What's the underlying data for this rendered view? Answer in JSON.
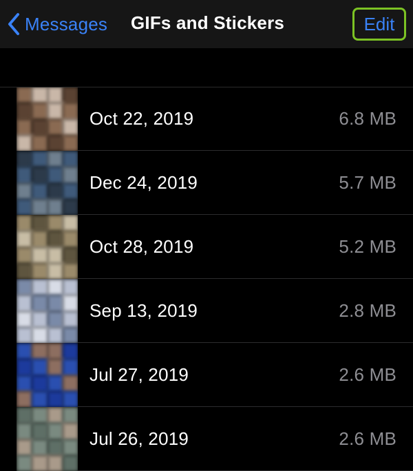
{
  "navbar": {
    "back_label": "Messages",
    "title": "GIFs and Stickers",
    "edit_label": "Edit"
  },
  "colors": {
    "accent": "#3a82f7",
    "highlight_outline": "#7cc324",
    "secondary_text": "#8e8e93"
  },
  "items": [
    {
      "date": "Oct 22, 2019",
      "size": "6.8 MB",
      "thumb_colors": [
        "#8a6a52",
        "#c9b7a8",
        "#5a4232"
      ]
    },
    {
      "date": "Dec 24, 2019",
      "size": "5.7 MB",
      "thumb_colors": [
        "#3f5a7a",
        "#6f7f8e",
        "#2c3a4a"
      ]
    },
    {
      "date": "Oct 28, 2019",
      "size": "5.2 MB",
      "thumb_colors": [
        "#9a8a6a",
        "#c8bda5",
        "#5e553f"
      ]
    },
    {
      "date": "Sep 13, 2019",
      "size": "2.8 MB",
      "thumb_colors": [
        "#b9c0d2",
        "#7a8aa8",
        "#d8dce6"
      ]
    },
    {
      "date": "Jul 27, 2019",
      "size": "2.6 MB",
      "thumb_colors": [
        "#2a4fb0",
        "#8d6e60",
        "#1c3a9c"
      ]
    },
    {
      "date": "Jul 26, 2019",
      "size": "2.6 MB",
      "thumb_colors": [
        "#7a8a80",
        "#a99a8a",
        "#5e6f66"
      ]
    }
  ]
}
